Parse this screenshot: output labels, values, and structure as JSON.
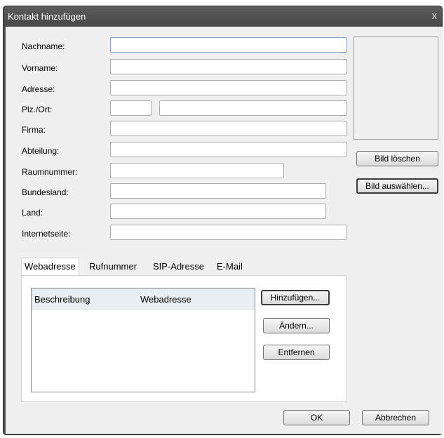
{
  "window": {
    "title": "Kontakt hinzufügen",
    "close_glyph": "x"
  },
  "form": {
    "nachname": {
      "label": "Nachname:",
      "value": ""
    },
    "vorname": {
      "label": "Vorname:",
      "value": ""
    },
    "adresse": {
      "label": "Adresse:",
      "value": ""
    },
    "plz_ort": {
      "label": "Plz./Ort:",
      "plz_value": "",
      "ort_value": ""
    },
    "firma": {
      "label": "Firma:",
      "value": ""
    },
    "abteilung": {
      "label": "Abteilung:",
      "value": ""
    },
    "raumnummer": {
      "label": "Raumnummer:",
      "value": ""
    },
    "bundesland": {
      "label": "Bundesland:",
      "value": ""
    },
    "land": {
      "label": "Land:",
      "value": ""
    },
    "internetseite": {
      "label": "Internetseite:",
      "value": ""
    }
  },
  "photo": {
    "delete_label": "Bild löschen",
    "select_label": "Bild auswählen..."
  },
  "tabs": [
    {
      "label": "Webadresse",
      "active": true
    },
    {
      "label": "Rufnummer",
      "active": false
    },
    {
      "label": "SIP-Adresse",
      "active": false
    },
    {
      "label": "E-Mail",
      "active": false
    }
  ],
  "weblist": {
    "columns": [
      "Beschreibung",
      "Webadresse"
    ],
    "rows": []
  },
  "list_buttons": {
    "add": "Hinzufügen...",
    "edit": "Ändern...",
    "remove": "Entfernen"
  },
  "footer": {
    "ok": "OK",
    "cancel": "Abbrechen"
  },
  "colors": {
    "titlebar": "#525252",
    "dialog_bg": "#f0f0f0",
    "input_border": "#abadb3"
  }
}
